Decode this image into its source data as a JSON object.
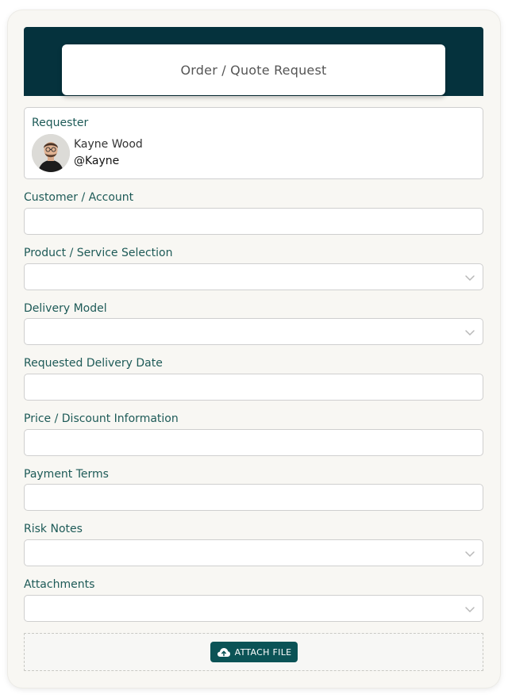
{
  "form": {
    "title": "Order / Quote Request"
  },
  "requester": {
    "label": "Requester",
    "name": "Kayne Wood",
    "handle": "@Kayne"
  },
  "fields": [
    {
      "label": "Customer / Account",
      "type": "text",
      "value": ""
    },
    {
      "label": "Product / Service Selection",
      "type": "select",
      "value": ""
    },
    {
      "label": "Delivery Model",
      "type": "select",
      "value": ""
    },
    {
      "label": "Requested Delivery Date",
      "type": "text",
      "value": ""
    },
    {
      "label": "Price / Discount Information",
      "type": "text",
      "value": ""
    },
    {
      "label": "Payment Terms",
      "type": "text",
      "value": ""
    },
    {
      "label": "Risk Notes",
      "type": "select",
      "value": ""
    },
    {
      "label": "Attachments",
      "type": "select",
      "value": ""
    }
  ],
  "attach": {
    "button_label": "ATTACH FILE",
    "icon": "cloud-upload-icon"
  },
  "colors": {
    "header": "#05323d",
    "label": "#1d5a57",
    "button": "#0b5356"
  }
}
